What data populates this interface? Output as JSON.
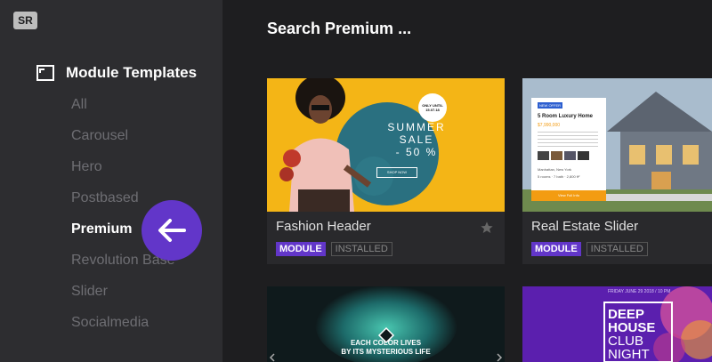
{
  "sidebar": {
    "logo": "SR",
    "section_title": "Module Templates",
    "items": [
      {
        "label": "All"
      },
      {
        "label": "Carousel"
      },
      {
        "label": "Hero"
      },
      {
        "label": "Postbased"
      },
      {
        "label": "Premium",
        "active": true
      },
      {
        "label": "Revolution Base"
      },
      {
        "label": "Slider"
      },
      {
        "label": "Socialmedia"
      }
    ]
  },
  "main": {
    "title": "Search Premium ...",
    "cards": [
      {
        "name": "Fashion Header",
        "badge_type": "MODULE",
        "badge_status": "INSTALLED",
        "preview": {
          "line1": "SUMMER",
          "line2": "SALE",
          "line3": "- 50 %",
          "button": "SHOP NOW",
          "sticker_line1": "ONLY UNTIL",
          "sticker_line2": "15.07.18"
        }
      },
      {
        "name": "Real Estate Slider",
        "badge_type": "MODULE",
        "badge_status": "INSTALLED",
        "preview": {
          "tag": "NEW OFFER",
          "heading": "5 Room Luxury Home",
          "price": "$7,990,000",
          "location": "Manhattan, New York",
          "stats": "5 rooms · 7 bath · 2,800 ft²",
          "button": "View Full Info"
        }
      },
      {
        "preview": {
          "line1": "EACH COLOR LIVES",
          "line2": "BY ITS MYSTERIOUS LIFE"
        }
      },
      {
        "preview": {
          "date": "FRIDAY JUNE 29 2018 / 10 PM",
          "line1": "DEEP",
          "line2": "HOUSE",
          "line3": "CLUB",
          "line4": "NIGHT"
        }
      }
    ]
  },
  "colors": {
    "accent": "#6236c9",
    "sidebar_bg": "#2d2d30",
    "main_bg": "#1e1e20",
    "card_bg": "#29292c"
  }
}
